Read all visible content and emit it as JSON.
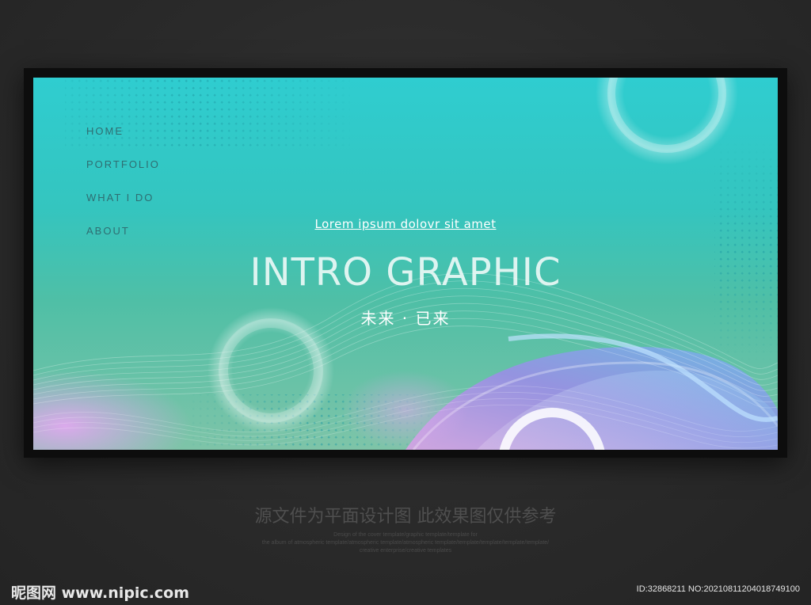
{
  "nav": {
    "items": [
      {
        "label": "HOME"
      },
      {
        "label": "PORTFOLIO"
      },
      {
        "label": "WHAT I DO"
      },
      {
        "label": "ABOUT"
      }
    ]
  },
  "hero": {
    "link_text": "Lorem ipsum dolovr sit amet",
    "title": "INTRO GRAPHIC",
    "subtitle_cn": "未来 · 已来"
  },
  "caption": {
    "main": "源文件为平面设计图 此效果图仅供参考",
    "line1": "Design of the cover template/graphic template/template for",
    "line2": "the album of atmospheric template/atmospheric template/atmospheric template/template/template/template/template/",
    "line3": "creative enterprise/creative templates"
  },
  "watermark": {
    "logo_text": "昵图网 www.nipic.com",
    "id_text": "ID:32868211 NO:20210811204018749100"
  },
  "colors": {
    "background": "#2b2b2b",
    "banner_top": "#2fcdd0",
    "banner_bottom": "#7ec4a8",
    "nav_text": "#2f6e72",
    "accent_purple": "#b48be0",
    "accent_blue": "#7fb8ee"
  }
}
